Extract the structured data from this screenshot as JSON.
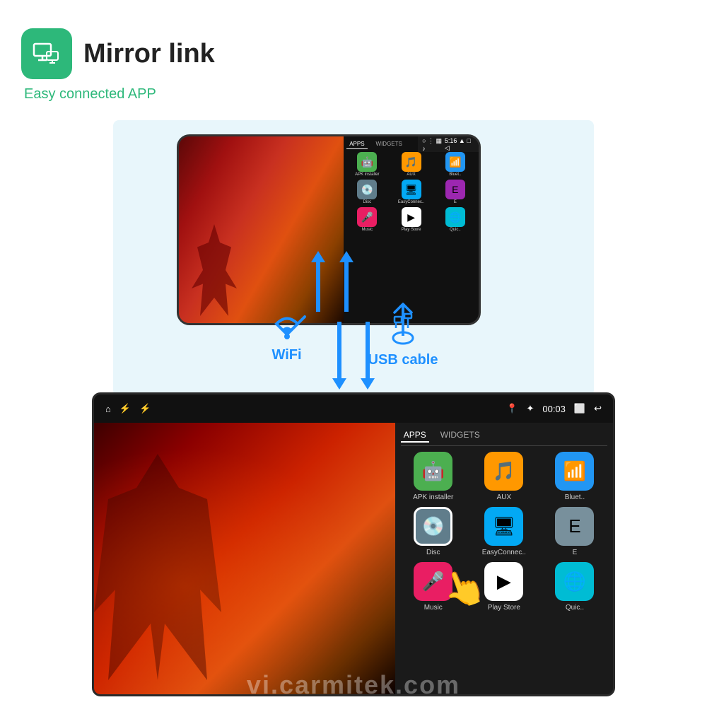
{
  "header": {
    "title": "Mirror link",
    "subtitle": "Easy connected APP",
    "icon_name": "mirror-link-icon"
  },
  "connection": {
    "wifi_label": "WiFi",
    "usb_label": "USB cable"
  },
  "phone": {
    "status_time": "5:16",
    "tabs": [
      "APPS",
      "WIDGETS"
    ],
    "apps": [
      {
        "label": "APK installer",
        "icon": "🤖",
        "bg": "#4CAF50"
      },
      {
        "label": "AUX",
        "icon": "🎵",
        "bg": "#FF9800"
      },
      {
        "label": "Bluet..",
        "icon": "📶",
        "bg": "#2196F3"
      },
      {
        "label": "Disc",
        "icon": "💿",
        "bg": "#607D8B"
      },
      {
        "label": "EasyConnec..",
        "icon": "🖥",
        "bg": "#03A9F4"
      },
      {
        "label": "E",
        "icon": "📱",
        "bg": "#9C27B0"
      },
      {
        "label": "Music",
        "icon": "🎤",
        "bg": "#E91E63"
      },
      {
        "label": "Play Store",
        "icon": "▶",
        "bg": "#fff"
      },
      {
        "label": "Quic..",
        "icon": "🌐",
        "bg": "#00BCD4"
      }
    ]
  },
  "car_screen": {
    "status_left": [
      "🏠",
      "⚡",
      "⚡"
    ],
    "status_right": [
      "📍",
      "🔵",
      "00:03",
      "⬜",
      "↩"
    ],
    "tabs": [
      "APPS",
      "WIDGETS"
    ],
    "apps": [
      {
        "label": "APK installer",
        "icon": "🤖",
        "bg": "#4CAF50"
      },
      {
        "label": "AUX",
        "icon": "🎵",
        "bg": "#FF9800"
      },
      {
        "label": "Bluet..",
        "icon": "📶",
        "bg": "#2196F3"
      },
      {
        "label": "Disc",
        "icon": "💿",
        "bg": "#607D8B"
      },
      {
        "label": "EasyConnec..",
        "icon": "🖥",
        "bg": "#03A9F4"
      },
      {
        "label": "E",
        "icon": "📱",
        "bg": "#9C27B0"
      },
      {
        "label": "Music",
        "icon": "🎤",
        "bg": "#E91E63"
      },
      {
        "label": "Play Store",
        "icon": "▶",
        "bg": "#fff"
      },
      {
        "label": "Quic..",
        "icon": "🌐",
        "bg": "#00BCD4"
      }
    ]
  },
  "watermark": {
    "text": "vi.carmitek.com"
  }
}
